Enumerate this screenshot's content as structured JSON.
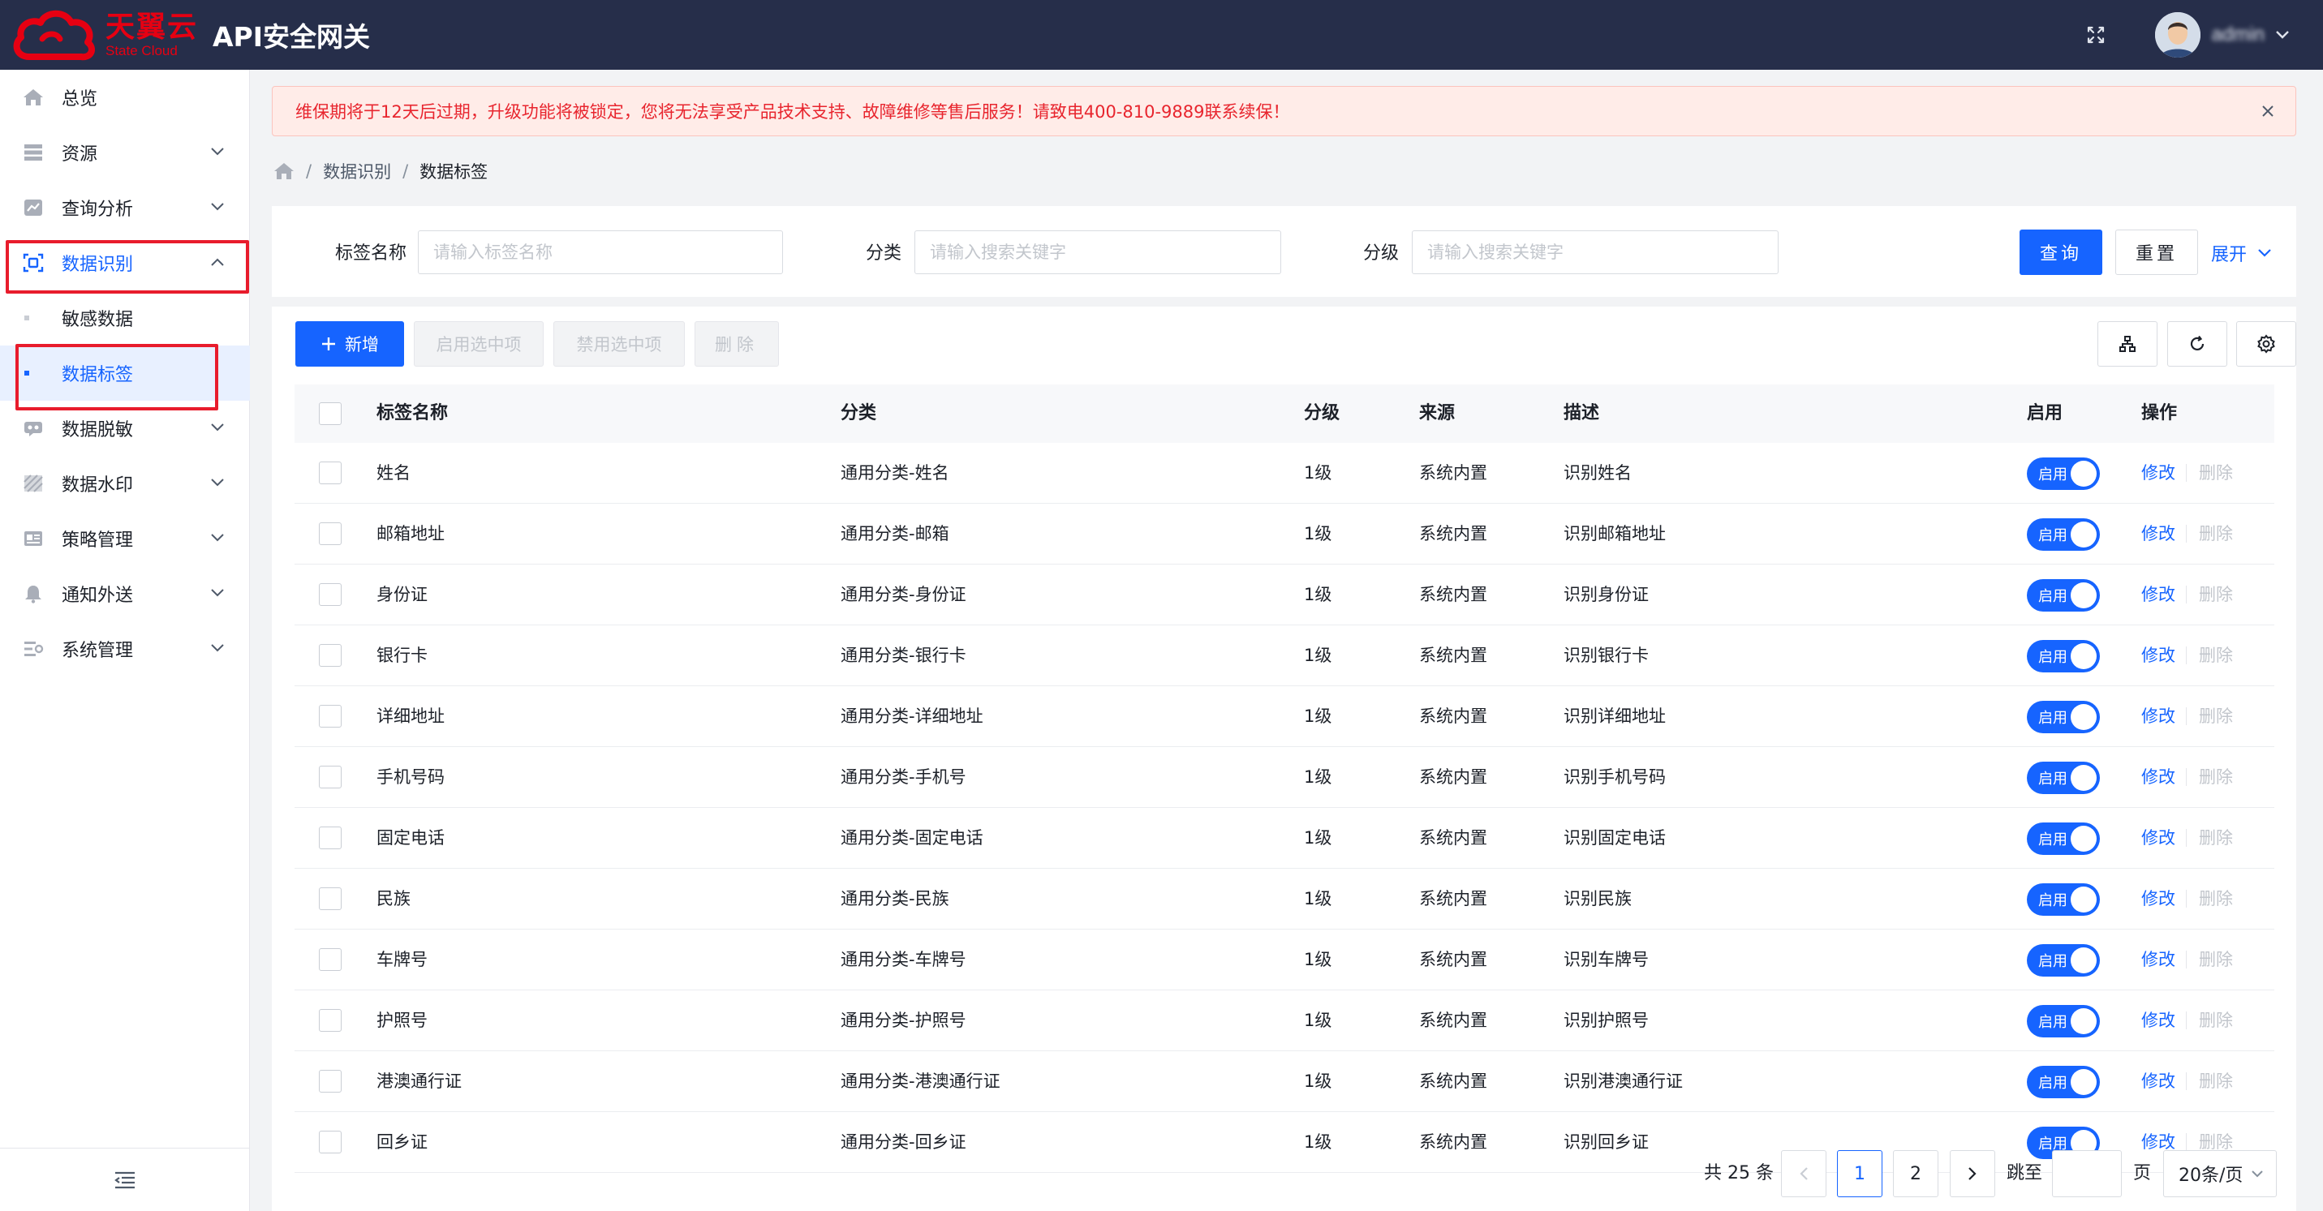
{
  "header": {
    "logo_cn": "天翼云",
    "logo_en": "State Cloud",
    "app_title": "API安全网关",
    "username": "admin",
    "brand_color": "#e60012",
    "bg_color": "#262e4a"
  },
  "sidebar": {
    "items": [
      {
        "label": "总览",
        "icon": "home-icon"
      },
      {
        "label": "资源",
        "icon": "database-icon"
      },
      {
        "label": "查询分析",
        "icon": "chart-icon"
      },
      {
        "label": "数据识别",
        "icon": "scan-icon"
      },
      {
        "label": "数据脱敏",
        "icon": "mask-icon"
      },
      {
        "label": "数据水印",
        "icon": "watermark-icon"
      },
      {
        "label": "策略管理",
        "icon": "policy-icon"
      },
      {
        "label": "通知外送",
        "icon": "bell-icon"
      },
      {
        "label": "系统管理",
        "icon": "settings-icon"
      }
    ],
    "sub_items": [
      {
        "label": "敏感数据"
      },
      {
        "label": "数据标签"
      }
    ],
    "accent_color": "#1664ff"
  },
  "alert": {
    "text": "维保期将于12天后过期，升级功能将被锁定，您将无法享受产品技术支持、故障维修等售后服务！请致电400-810-9889联系续保！"
  },
  "breadcrumb": {
    "items": [
      "数据识别",
      "数据标签"
    ]
  },
  "filters": {
    "name_label": "标签名称",
    "name_placeholder": "请输入标签名称",
    "category_label": "分类",
    "category_placeholder": "请输入搜索关键字",
    "level_label": "分级",
    "level_placeholder": "请输入搜索关键字",
    "query_button": "查询",
    "reset_button": "重置",
    "expand_link": "展开"
  },
  "toolbar": {
    "add_button": "新增",
    "enable_selected": "启用选中项",
    "disable_selected": "禁用选中项",
    "delete_button": "删除"
  },
  "table": {
    "columns": [
      "标签名称",
      "分类",
      "分级",
      "来源",
      "描述",
      "启用",
      "操作"
    ],
    "switch_label": "启用",
    "edit_label": "修改",
    "delete_label": "删除",
    "rows": [
      {
        "name": "姓名",
        "category": "通用分类-姓名",
        "level": "1级",
        "source": "系统内置",
        "desc": "识别姓名"
      },
      {
        "name": "邮箱地址",
        "category": "通用分类-邮箱",
        "level": "1级",
        "source": "系统内置",
        "desc": "识别邮箱地址"
      },
      {
        "name": "身份证",
        "category": "通用分类-身份证",
        "level": "1级",
        "source": "系统内置",
        "desc": "识别身份证"
      },
      {
        "name": "银行卡",
        "category": "通用分类-银行卡",
        "level": "1级",
        "source": "系统内置",
        "desc": "识别银行卡"
      },
      {
        "name": "详细地址",
        "category": "通用分类-详细地址",
        "level": "1级",
        "source": "系统内置",
        "desc": "识别详细地址"
      },
      {
        "name": "手机号码",
        "category": "通用分类-手机号",
        "level": "1级",
        "source": "系统内置",
        "desc": "识别手机号码"
      },
      {
        "name": "固定电话",
        "category": "通用分类-固定电话",
        "level": "1级",
        "source": "系统内置",
        "desc": "识别固定电话"
      },
      {
        "name": "民族",
        "category": "通用分类-民族",
        "level": "1级",
        "source": "系统内置",
        "desc": "识别民族"
      },
      {
        "name": "车牌号",
        "category": "通用分类-车牌号",
        "level": "1级",
        "source": "系统内置",
        "desc": "识别车牌号"
      },
      {
        "name": "护照号",
        "category": "通用分类-护照号",
        "level": "1级",
        "source": "系统内置",
        "desc": "识别护照号"
      },
      {
        "name": "港澳通行证",
        "category": "通用分类-港澳通行证",
        "level": "1级",
        "source": "系统内置",
        "desc": "识别港澳通行证"
      },
      {
        "name": "回乡证",
        "category": "通用分类-回乡证",
        "level": "1级",
        "source": "系统内置",
        "desc": "识别回乡证"
      }
    ]
  },
  "pagination": {
    "total_text": "共 25 条",
    "pages": [
      "1",
      "2"
    ],
    "current_page": "1",
    "jump_label": "跳至",
    "page_unit": "页",
    "page_size": "20条/页"
  }
}
